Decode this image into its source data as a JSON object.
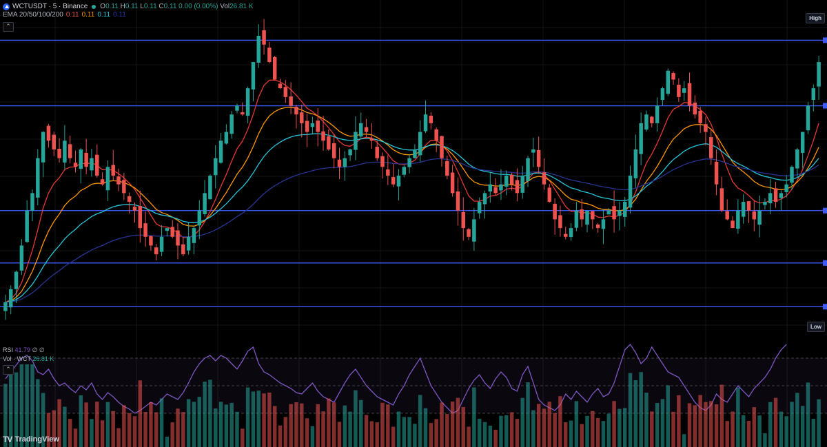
{
  "header": {
    "symbol": "WCTUSDT · 5 · Binance",
    "open_label": "O",
    "open": "0.11",
    "high_label": "H",
    "high": "0.11",
    "low_label": "L",
    "low": "0.11",
    "close_label": "C",
    "close": "0.11",
    "change": "0.00 (0.00%)",
    "vol_label": "Vol",
    "vol": "26.81 K"
  },
  "ema": {
    "label": "EMA 20/50/100/200",
    "v20": "0.11",
    "v50": "0.11",
    "v100": "0.11",
    "v200": "0.11"
  },
  "rsi": {
    "label": "RSI",
    "value": "41.79",
    "extra": "∅ ∅"
  },
  "volume": {
    "label": "Vol · WCT",
    "value": "26.81 K"
  },
  "tags": {
    "high": "High",
    "low": "Low"
  },
  "brand": {
    "logo": "TV",
    "name": "TradingView"
  },
  "colors": {
    "bg": "#000000",
    "up": "#26a69a",
    "down": "#ef5350",
    "hline": "#3d5afe",
    "ema20": "#e53935",
    "ema50": "#ff9800",
    "ema100": "#26c6da",
    "ema200": "#283593",
    "rsi": "#7e57c2"
  },
  "chart_data": {
    "type": "candlestick",
    "timeframe": "5",
    "horizontal_levels": [
      0.1235,
      0.116,
      0.104,
      0.098,
      0.093
    ],
    "price_range": [
      0.089,
      0.127
    ],
    "close": [
      0.0935,
      0.095,
      0.097,
      0.1,
      0.104,
      0.106,
      0.11,
      0.113,
      0.112,
      0.111,
      0.11,
      0.112,
      0.11,
      0.109,
      0.111,
      0.109,
      0.11,
      0.108,
      0.107,
      0.109,
      0.108,
      0.107,
      0.106,
      0.105,
      0.104,
      0.102,
      0.101,
      0.1,
      0.099,
      0.101,
      0.102,
      0.101,
      0.1,
      0.099,
      0.101,
      0.102,
      0.104,
      0.106,
      0.108,
      0.11,
      0.112,
      0.113,
      0.115,
      0.116,
      0.115,
      0.118,
      0.121,
      0.124,
      0.123,
      0.121,
      0.119,
      0.118,
      0.117,
      0.116,
      0.115,
      0.114,
      0.113,
      0.114,
      0.113,
      0.112,
      0.111,
      0.11,
      0.109,
      0.11,
      0.111,
      0.113,
      0.114,
      0.113,
      0.112,
      0.11,
      0.109,
      0.108,
      0.107,
      0.108,
      0.109,
      0.11,
      0.111,
      0.113,
      0.115,
      0.114,
      0.112,
      0.11,
      0.108,
      0.106,
      0.104,
      0.102,
      0.101,
      0.103,
      0.105,
      0.106,
      0.107,
      0.106,
      0.107,
      0.108,
      0.107,
      0.106,
      0.108,
      0.11,
      0.111,
      0.109,
      0.107,
      0.105,
      0.103,
      0.102,
      0.101,
      0.102,
      0.104,
      0.103,
      0.104,
      0.103,
      0.102,
      0.103,
      0.104,
      0.103,
      0.104,
      0.105,
      0.108,
      0.111,
      0.114,
      0.115,
      0.114,
      0.116,
      0.118,
      0.12,
      0.119,
      0.117,
      0.118,
      0.116,
      0.115,
      0.114,
      0.113,
      0.11,
      0.107,
      0.104,
      0.103,
      0.102,
      0.104,
      0.105,
      0.104,
      0.103,
      0.104,
      0.105,
      0.106,
      0.105,
      0.106,
      0.107,
      0.109,
      0.111,
      0.113,
      0.116,
      0.118,
      0.121
    ],
    "rsi": [
      55,
      60,
      65,
      70,
      72,
      68,
      60,
      58,
      62,
      55,
      50,
      52,
      48,
      45,
      50,
      47,
      52,
      44,
      40,
      45,
      42,
      38,
      35,
      33,
      30,
      32,
      35,
      38,
      36,
      40,
      44,
      42,
      40,
      45,
      52,
      60,
      66,
      70,
      72,
      68,
      72,
      70,
      66,
      62,
      68,
      75,
      78,
      66,
      60,
      58,
      55,
      52,
      50,
      48,
      45,
      44,
      48,
      52,
      46,
      42,
      40,
      38,
      45,
      52,
      58,
      62,
      56,
      50,
      46,
      42,
      40,
      38,
      36,
      44,
      50,
      58,
      64,
      70,
      60,
      50,
      44,
      38,
      34,
      30,
      32,
      40,
      48,
      54,
      58,
      52,
      48,
      55,
      60,
      56,
      48,
      46,
      58,
      64,
      52,
      40,
      36,
      34,
      32,
      36,
      44,
      40,
      46,
      42,
      38,
      44,
      48,
      42,
      44,
      52,
      64,
      76,
      80,
      74,
      66,
      70,
      78,
      72,
      66,
      60,
      58,
      56,
      50,
      44,
      38,
      34,
      32,
      36,
      44,
      40,
      38,
      44,
      50,
      46,
      42,
      48,
      52,
      56,
      62,
      70,
      76,
      80
    ],
    "volume_scale": "relative"
  }
}
